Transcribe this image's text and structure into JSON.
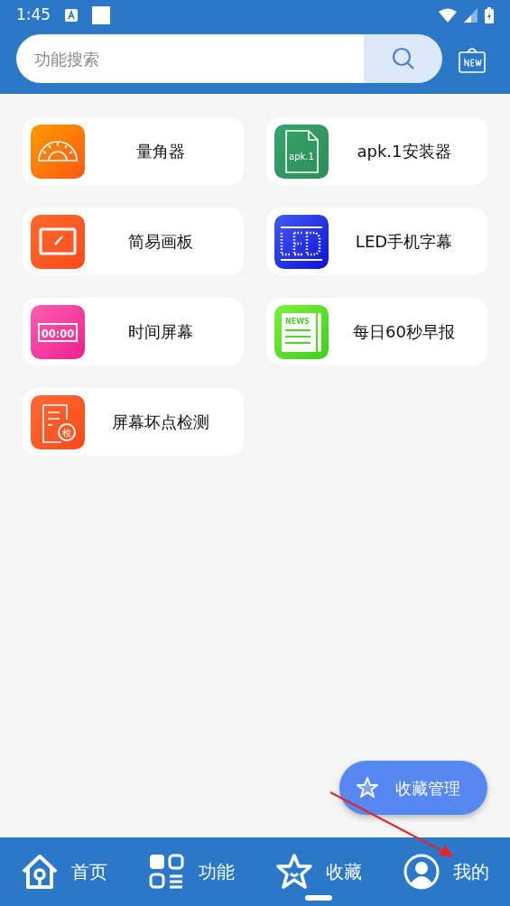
{
  "status_bar": {
    "time": "1:45"
  },
  "search": {
    "placeholder": "功能搜索"
  },
  "tools": [
    {
      "label": "量角器",
      "kind": "protractor"
    },
    {
      "label": "apk.1安装器",
      "kind": "file",
      "icon_text": "apk.1"
    },
    {
      "label": "简易画板",
      "kind": "tablet"
    },
    {
      "label": "LED手机字幕",
      "kind": "led"
    },
    {
      "label": "时间屏幕",
      "kind": "clock",
      "icon_text": "00:00"
    },
    {
      "label": "每日60秒早报",
      "kind": "news",
      "icon_text": "NEWS"
    },
    {
      "label": "屏幕坏点检测",
      "kind": "check",
      "icon_text": "检"
    }
  ],
  "fab": {
    "label": "收藏管理"
  },
  "nav": [
    {
      "label": "首页",
      "kind": "home",
      "selected": false
    },
    {
      "label": "功能",
      "kind": "apps",
      "selected": false
    },
    {
      "label": "收藏",
      "kind": "star",
      "selected": true
    },
    {
      "label": "我的",
      "kind": "user",
      "selected": false
    }
  ]
}
